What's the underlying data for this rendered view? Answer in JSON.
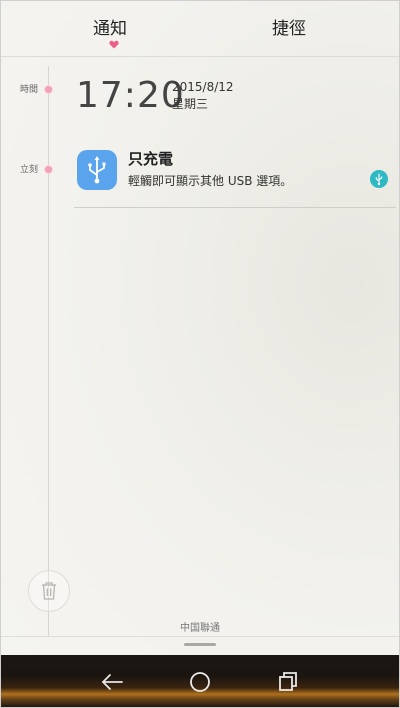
{
  "tabs": {
    "notifications": "通知",
    "shortcuts": "捷徑"
  },
  "timeline": {
    "time_label": "時間",
    "now_label": "立刻"
  },
  "clock": {
    "time": "17:20",
    "date": "2015/8/12",
    "weekday": "星期三"
  },
  "notification": {
    "title": "只充電",
    "text": "輕觸即可顯示其他 USB 選項。",
    "app_icon": "usb-icon",
    "small_icon": "usb-icon"
  },
  "footer": {
    "carrier": "中国聯通"
  },
  "navbar": {
    "back_icon": "back-icon",
    "home_icon": "home-icon",
    "recent_icon": "recent-apps-icon"
  },
  "colors": {
    "accent_pink": "#f3a2b6",
    "usb_blue": "#5aa4ee",
    "usb_teal": "#2fb9c4"
  }
}
